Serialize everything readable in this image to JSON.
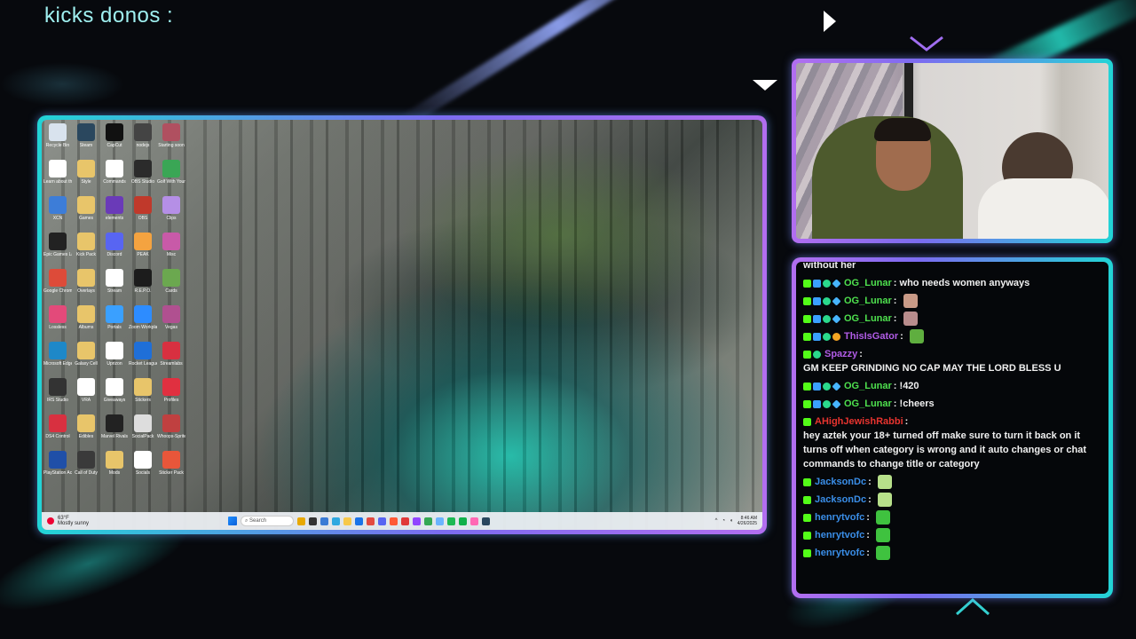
{
  "overlay": {
    "title": "kicks donos :"
  },
  "desktop": {
    "icons": [
      {
        "label": "Recycle Bin",
        "color": "#d9e3ee"
      },
      {
        "label": "Steam",
        "color": "#2a475e"
      },
      {
        "label": "CapCut",
        "color": "#111111"
      },
      {
        "label": "nodejs",
        "color": "#444444"
      },
      {
        "label": "Starting soon",
        "color": "#b05060"
      },
      {
        "label": "Learn about this picture",
        "color": "#ffffff"
      },
      {
        "label": "Style",
        "color": "#e8c56a"
      },
      {
        "label": "Commands",
        "color": "#ffffff"
      },
      {
        "label": "OBS Studio",
        "color": "#2b2b2b"
      },
      {
        "label": "Golf With Your Friends",
        "color": "#3aa655"
      },
      {
        "label": "XCN",
        "color": "#3d7dd8"
      },
      {
        "label": "Games",
        "color": "#e8c56a"
      },
      {
        "label": "elements",
        "color": "#6a3ab8"
      },
      {
        "label": "OBS",
        "color": "#c0392b"
      },
      {
        "label": "Clips",
        "color": "#b58fe6"
      },
      {
        "label": "Epic Games Launcher",
        "color": "#222222"
      },
      {
        "label": "Kick Pack",
        "color": "#e8c56a"
      },
      {
        "label": "Discord",
        "color": "#5865f2"
      },
      {
        "label": "PEAK",
        "color": "#f4a340"
      },
      {
        "label": "Misc",
        "color": "#c85aa8"
      },
      {
        "label": "Google Chrome",
        "color": "#dd4b39"
      },
      {
        "label": "Overlays",
        "color": "#e8c56a"
      },
      {
        "label": "Stream",
        "color": "#ffffff"
      },
      {
        "label": "R.E.P.O.",
        "color": "#1c1c1c"
      },
      {
        "label": "Cards",
        "color": "#6ba84f"
      },
      {
        "label": "Lossless",
        "color": "#e34a7a"
      },
      {
        "label": "Albums",
        "color": "#e8c56a"
      },
      {
        "label": "Portals",
        "color": "#3aa0ff"
      },
      {
        "label": "Zoom Workplace",
        "color": "#2d8cff"
      },
      {
        "label": "Vegas",
        "color": "#b05090"
      },
      {
        "label": "Microsoft Edge",
        "color": "#1e88c8"
      },
      {
        "label": "Galaxy Cell",
        "color": "#e8c56a"
      },
      {
        "label": "Uprizon",
        "color": "#ffffff"
      },
      {
        "label": "Rocket League",
        "color": "#1f6fd8"
      },
      {
        "label": "Streamlabs",
        "color": "#d83040"
      },
      {
        "label": "IRS Studio",
        "color": "#333333"
      },
      {
        "label": "VRA",
        "color": "#ffffff"
      },
      {
        "label": "Giveaways",
        "color": "#ffffff"
      },
      {
        "label": "Stickers",
        "color": "#e8c56a"
      },
      {
        "label": "Profiles",
        "color": "#e03040"
      },
      {
        "label": "DS4 Control",
        "color": "#d83040"
      },
      {
        "label": "Edibles",
        "color": "#e8c56a"
      },
      {
        "label": "Marvel Rivals",
        "color": "#222222"
      },
      {
        "label": "SocialPack",
        "color": "#dddddd"
      },
      {
        "label": "Whoops-Sprite",
        "color": "#c04040"
      },
      {
        "label": "PlayStation Accessories",
        "color": "#1f4fa8"
      },
      {
        "label": "Call of Duty",
        "color": "#3a3a3a"
      },
      {
        "label": "Mods",
        "color": "#e8c56a"
      },
      {
        "label": "Socials",
        "color": "#ffffff"
      },
      {
        "label": "Sticker Pack",
        "color": "#e8563a"
      }
    ]
  },
  "taskbar": {
    "weather_line1": "63°F",
    "weather_line2": "Mostly sunny",
    "search_placeholder": "Search",
    "apps": [
      "#e8a800",
      "#333333",
      "#3a7bd5",
      "#2ea8e0",
      "#f7c84a",
      "#1a73e8",
      "#e34a40",
      "#5865f2",
      "#ff5a36",
      "#e03a3a",
      "#9146ff",
      "#34a853",
      "#6bb4ff",
      "#1db954",
      "#10b04a",
      "#ff69b4",
      "#2a475e"
    ],
    "time": "8:46 AM",
    "date": "4/26/2025"
  },
  "chat": {
    "partial_top": "without her",
    "messages": [
      {
        "user": "OG_Lunar",
        "user_color": "#4ee04e",
        "badges": [
          "k",
          "blue",
          "green",
          "cube"
        ],
        "text": "who needs women anyways",
        "emote": null
      },
      {
        "user": "OG_Lunar",
        "user_color": "#4ee04e",
        "badges": [
          "k",
          "blue",
          "green",
          "cube"
        ],
        "text": "",
        "emote": "#c99a87"
      },
      {
        "user": "OG_Lunar",
        "user_color": "#4ee04e",
        "badges": [
          "k",
          "blue",
          "green",
          "cube"
        ],
        "text": "",
        "emote": "#b98c8c"
      },
      {
        "user": "ThisIsGator",
        "user_color": "#b15ce6",
        "badges": [
          "k",
          "blue",
          "green",
          "orange"
        ],
        "text": "",
        "emote": "#5fae3f"
      },
      {
        "user": "Spazzy",
        "user_color": "#b15ce6",
        "badges": [
          "k",
          "green"
        ],
        "text": "GM KEEP GRINDING NO CAP MAY THE LORD BLESS U",
        "emote": null
      },
      {
        "user": "OG_Lunar",
        "user_color": "#4ee04e",
        "badges": [
          "k",
          "blue",
          "green",
          "cube"
        ],
        "text": "!420",
        "emote": null
      },
      {
        "user": "OG_Lunar",
        "user_color": "#4ee04e",
        "badges": [
          "k",
          "blue",
          "green",
          "cube"
        ],
        "text": "!cheers",
        "emote": null
      },
      {
        "user": "AHighJewishRabbi",
        "user_color": "#e8342f",
        "badges": [
          "k"
        ],
        "text": "hey aztek your 18+ turned off make sure to turn it back on it turns off when category is wrong and it auto changes or chat commands to change title or category",
        "emote": null
      },
      {
        "user": "JacksonDc",
        "user_color": "#3a8ee8",
        "badges": [
          "k"
        ],
        "text": "",
        "emote": "#b7e08a"
      },
      {
        "user": "JacksonDc",
        "user_color": "#3a8ee8",
        "badges": [
          "k"
        ],
        "text": "",
        "emote": "#b7e08a"
      },
      {
        "user": "henrytvofc",
        "user_color": "#3a8ee8",
        "badges": [
          "k"
        ],
        "text": "",
        "emote": "#3fc23f"
      },
      {
        "user": "henrytvofc",
        "user_color": "#3a8ee8",
        "badges": [
          "k"
        ],
        "text": "",
        "emote": "#3fc23f"
      },
      {
        "user": "henrytvofc",
        "user_color": "#3a8ee8",
        "badges": [
          "k"
        ],
        "text": "",
        "emote": "#3fc23f"
      }
    ]
  }
}
